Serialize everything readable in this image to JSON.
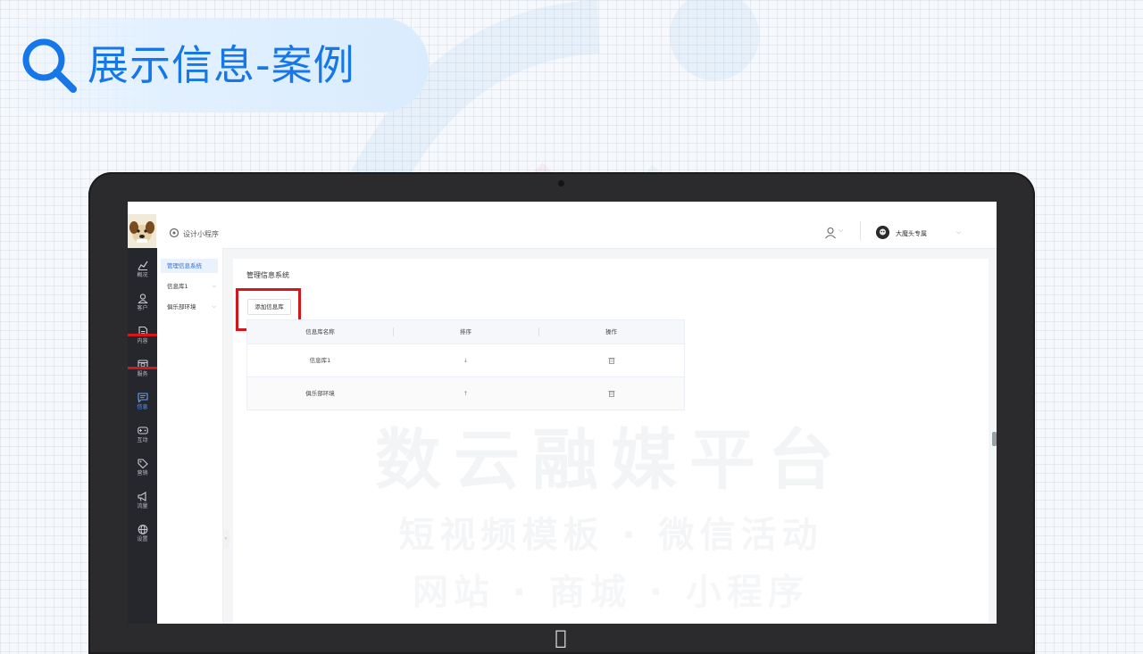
{
  "page": {
    "title": "展示信息-案例"
  },
  "header": {
    "app_title": "设计小程序",
    "user_name": "大魔头专属"
  },
  "rail": {
    "items": [
      {
        "label": "概况",
        "icon": "chart-icon"
      },
      {
        "label": "客户",
        "icon": "user-icon"
      },
      {
        "label": "内容",
        "icon": "document-icon"
      },
      {
        "label": "服务",
        "icon": "service-icon"
      },
      {
        "label": "信息",
        "icon": "message-icon",
        "active": true
      },
      {
        "label": "互动",
        "icon": "gamepad-icon"
      },
      {
        "label": "营销",
        "icon": "tag-icon"
      },
      {
        "label": "流量",
        "icon": "megaphone-icon"
      },
      {
        "label": "设置",
        "icon": "globe-icon"
      }
    ]
  },
  "submenu": {
    "items": [
      {
        "label": "管理信息系统",
        "active": true
      },
      {
        "label": "信息库1"
      },
      {
        "label": "俱乐部环境"
      }
    ]
  },
  "content": {
    "title": "管理信息系统",
    "add_button": "添加信息库",
    "table": {
      "headers": [
        "信息库名称",
        "排序",
        "操作"
      ],
      "rows": [
        {
          "name": "信息库1",
          "sort": "↓"
        },
        {
          "name": "俱乐部环境",
          "sort": "↑"
        }
      ]
    }
  },
  "watermark": {
    "line1": "数云融媒平台",
    "line2": "短视频模板 · 微信活动",
    "line3": "网站 · 商城 · 小程序"
  },
  "colors": {
    "accent": "#1677e8",
    "highlight": "#d4171c",
    "rail_bg": "#25272d"
  }
}
